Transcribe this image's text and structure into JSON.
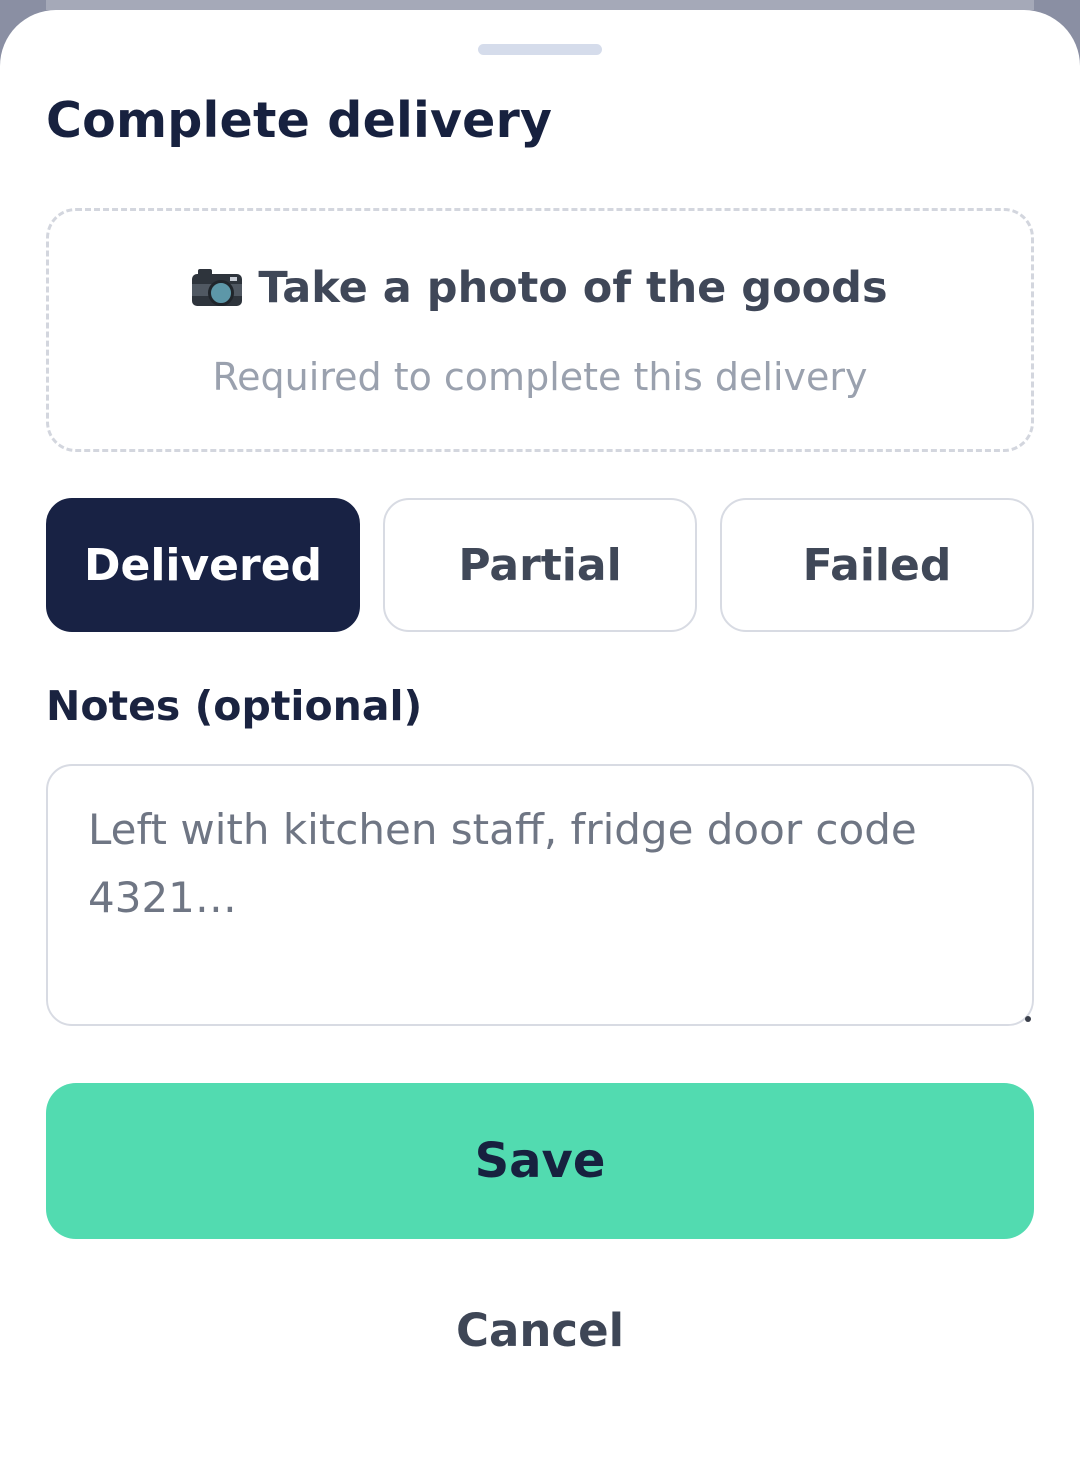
{
  "sheet": {
    "title": "Complete delivery"
  },
  "photo": {
    "icon": "camera-icon",
    "label": "Take a photo of the goods",
    "hint": "Required to complete this delivery"
  },
  "status": {
    "selected": "Delivered",
    "options": [
      {
        "label": "Delivered",
        "active": true
      },
      {
        "label": "Partial",
        "active": false
      },
      {
        "label": "Failed",
        "active": false
      }
    ]
  },
  "notes": {
    "label": "Notes (optional)",
    "placeholder": "Left with kitchen staff, fridge door code 4321…",
    "value": ""
  },
  "actions": {
    "save_label": "Save",
    "cancel_label": "Cancel"
  },
  "colors": {
    "primary_dark": "#182244",
    "accent_green": "#52dbb0",
    "title_text": "#17213f"
  }
}
